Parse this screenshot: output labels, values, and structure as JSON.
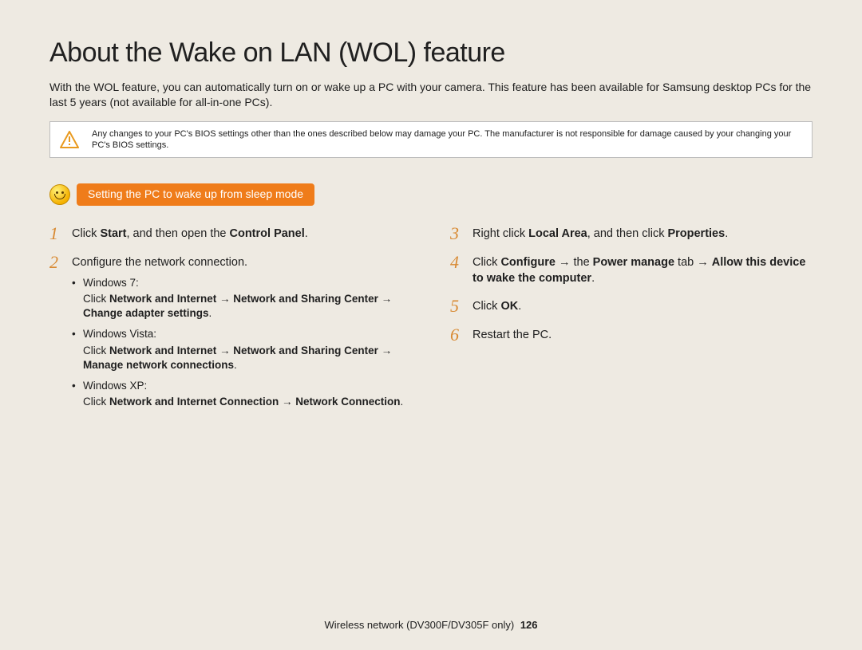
{
  "title": "About the Wake on LAN (WOL) feature",
  "intro": "With the WOL feature, you can automatically turn on or wake up a PC with your camera. This feature has been available for Samsung desktop PCs for the last 5 years (not available for all-in-one PCs).",
  "warning": "Any changes to your PC's BIOS settings other than the ones described below may damage your PC. The manufacturer is not responsible for damage caused by your changing your PC's BIOS settings.",
  "section_pill": "Setting the PC to wake up from sleep mode",
  "left": {
    "s1": {
      "num": "1",
      "a": "Click ",
      "b": "Start",
      "c": ", and then open the ",
      "d": "Control Panel",
      "e": "."
    },
    "s2": {
      "num": "2",
      "lead": "Configure the network connection.",
      "w7_label": "Windows 7:",
      "w7_a": "Click ",
      "w7_b": "Network and Internet",
      "w7_c": " → ",
      "w7_d": "Network and Sharing Center",
      "w7_e": " → ",
      "w7_f": "Change adapter settings",
      "w7_g": ".",
      "wv_label": "Windows Vista:",
      "wv_a": "Click ",
      "wv_b": "Network and Internet",
      "wv_c": " → ",
      "wv_d": "Network and Sharing Center",
      "wv_e": " → ",
      "wv_f": "Manage network connections",
      "wv_g": ".",
      "wx_label": "Windows XP:",
      "wx_a": "Click ",
      "wx_b": "Network and Internet Connection",
      "wx_c": " → ",
      "wx_d": "Network Connection",
      "wx_e": "."
    }
  },
  "right": {
    "s3": {
      "num": "3",
      "a": "Right click ",
      "b": "Local Area",
      "c": ", and then click ",
      "d": "Properties",
      "e": "."
    },
    "s4": {
      "num": "4",
      "a": "Click ",
      "b": "Configure",
      "c": " → the ",
      "d": "Power manage",
      "e": " tab → ",
      "f": "Allow this device to wake the computer",
      "g": "."
    },
    "s5": {
      "num": "5",
      "a": "Click ",
      "b": "OK",
      "c": "."
    },
    "s6": {
      "num": "6",
      "a": "Restart the PC."
    }
  },
  "footer": {
    "text": "Wireless network (DV300F/DV305F only)",
    "page": "126"
  }
}
